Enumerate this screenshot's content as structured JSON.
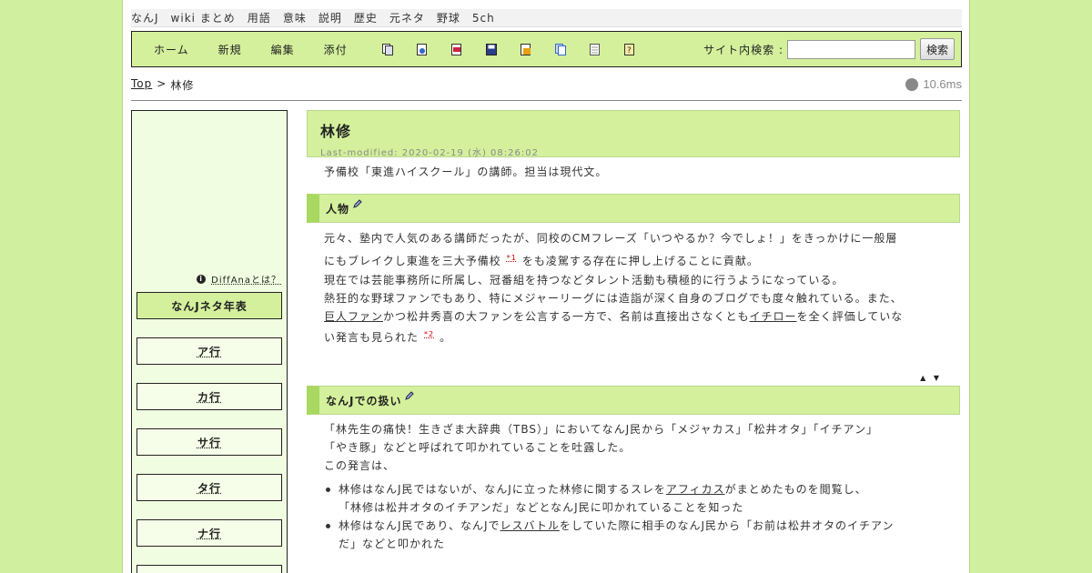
{
  "sitenav": [
    "なんJ",
    "wiki まとめ",
    "用語",
    "意味",
    "説明",
    "歴史",
    "元ネタ",
    "野球",
    "5ch"
  ],
  "toolbar": {
    "links": [
      "ホーム",
      "新規",
      "編集",
      "添付"
    ],
    "icons": [
      "copy-icon",
      "rename-icon",
      "diff-icon",
      "backup-icon",
      "freeze-icon",
      "list-icon",
      "recent-icon",
      "help-icon"
    ],
    "search_label": "サイト内検索 :",
    "search_button": "検索",
    "search_value": ""
  },
  "breadcrumb": {
    "top": "Top",
    "sep": ">",
    "current": "林修"
  },
  "timing": "10.6ms",
  "sidebar": {
    "diffana": "DiffAnaとは？",
    "main_button": "なんJネタ年表",
    "buttons": [
      "ア行",
      "カ行",
      "サ行",
      "タ行",
      "ナ行"
    ]
  },
  "page": {
    "title": "林修",
    "last_modified": "Last-modified: 2020-02-19 (水) 08:26:02",
    "intro": "予備校「東進ハイスクール」の講師。担当は現代文。"
  },
  "section1": {
    "heading": "人物",
    "p1_a": "元々、塾内で人気のある講師だったが、同校のCMフレーズ「いつやるか？今でしょ！」をきっかけに一般層",
    "p1_b1": "にもブレイクし東進を三大予備校",
    "fn1": "*1",
    "p1_b2": "をも凌駕する存在に押し上げることに貢献。",
    "p2": "現在では芸能事務所に所属し、冠番組を持つなどタレント活動も積極的に行うようになっている。",
    "p3_a": "熱狂的な野球ファンでもあり、特にメジャーリーグには造詣が深く自身のブログでも度々触れている。また、",
    "p3_link1": "巨人ファン",
    "p3_b1": "かつ松井秀喜の大ファンを公言する一方で、名前は直接出さなくとも",
    "p3_link2": "イチロー",
    "p3_b2": "を全く評価していな",
    "p3_c1": "い発言も見られた",
    "fn2": "*2",
    "p3_c2": "。",
    "updown": "▲ ▼"
  },
  "section2": {
    "heading": "なんJでの扱い",
    "p1_a": "「林先生の痛快！生きざま大辞典（TBS）」においてなんJ民から「メジャカス」「松井オタ」「イチアン」",
    "p1_b": "「やき豚」などと呼ばれて叩かれていることを吐露した。",
    "p2": "この発言は、",
    "li1_a1": "林修はなんJ民ではないが、なんJに立った林修に関するスレを",
    "li1_link": "アフィカス",
    "li1_a2": "がまとめたものを閲覧し、",
    "li1_b": "「林修は松井オタのイチアンだ」などとなんJ民に叩かれていることを知った",
    "li2_a1": "林修はなんJ民であり、なんJで",
    "li2_link": "レスバトル",
    "li2_a2": "をしていた際に相手のなんJ民から「お前は松井オタのイチアン",
    "li2_b": "だ」などと叩かれた"
  }
}
